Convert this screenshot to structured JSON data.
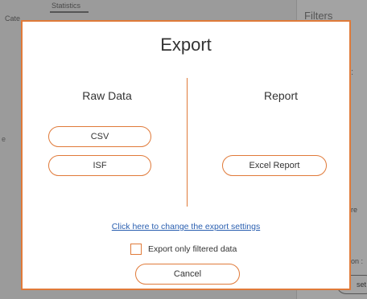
{
  "background": {
    "tab_left_text": "Cate",
    "tab_mid_text": "Statistics",
    "filters_title": "Filters",
    "colon_text": ":",
    "re_text": "re",
    "on_text": "on :",
    "reset_label": "set",
    "left_mark": "e"
  },
  "dialog": {
    "title": "Export",
    "raw_data": {
      "heading": "Raw Data",
      "buttons": [
        "CSV",
        "ISF"
      ]
    },
    "report": {
      "heading": "Report",
      "buttons": [
        "Excel Report"
      ]
    },
    "settings_link": "Click here to change the export settings",
    "filter_checkbox": {
      "label": "Export only filtered data",
      "checked": false
    },
    "cancel_label": "Cancel"
  },
  "colors": {
    "accent": "#e07a39",
    "link": "#2a5fb0",
    "overlay": "#9b9b9b"
  }
}
